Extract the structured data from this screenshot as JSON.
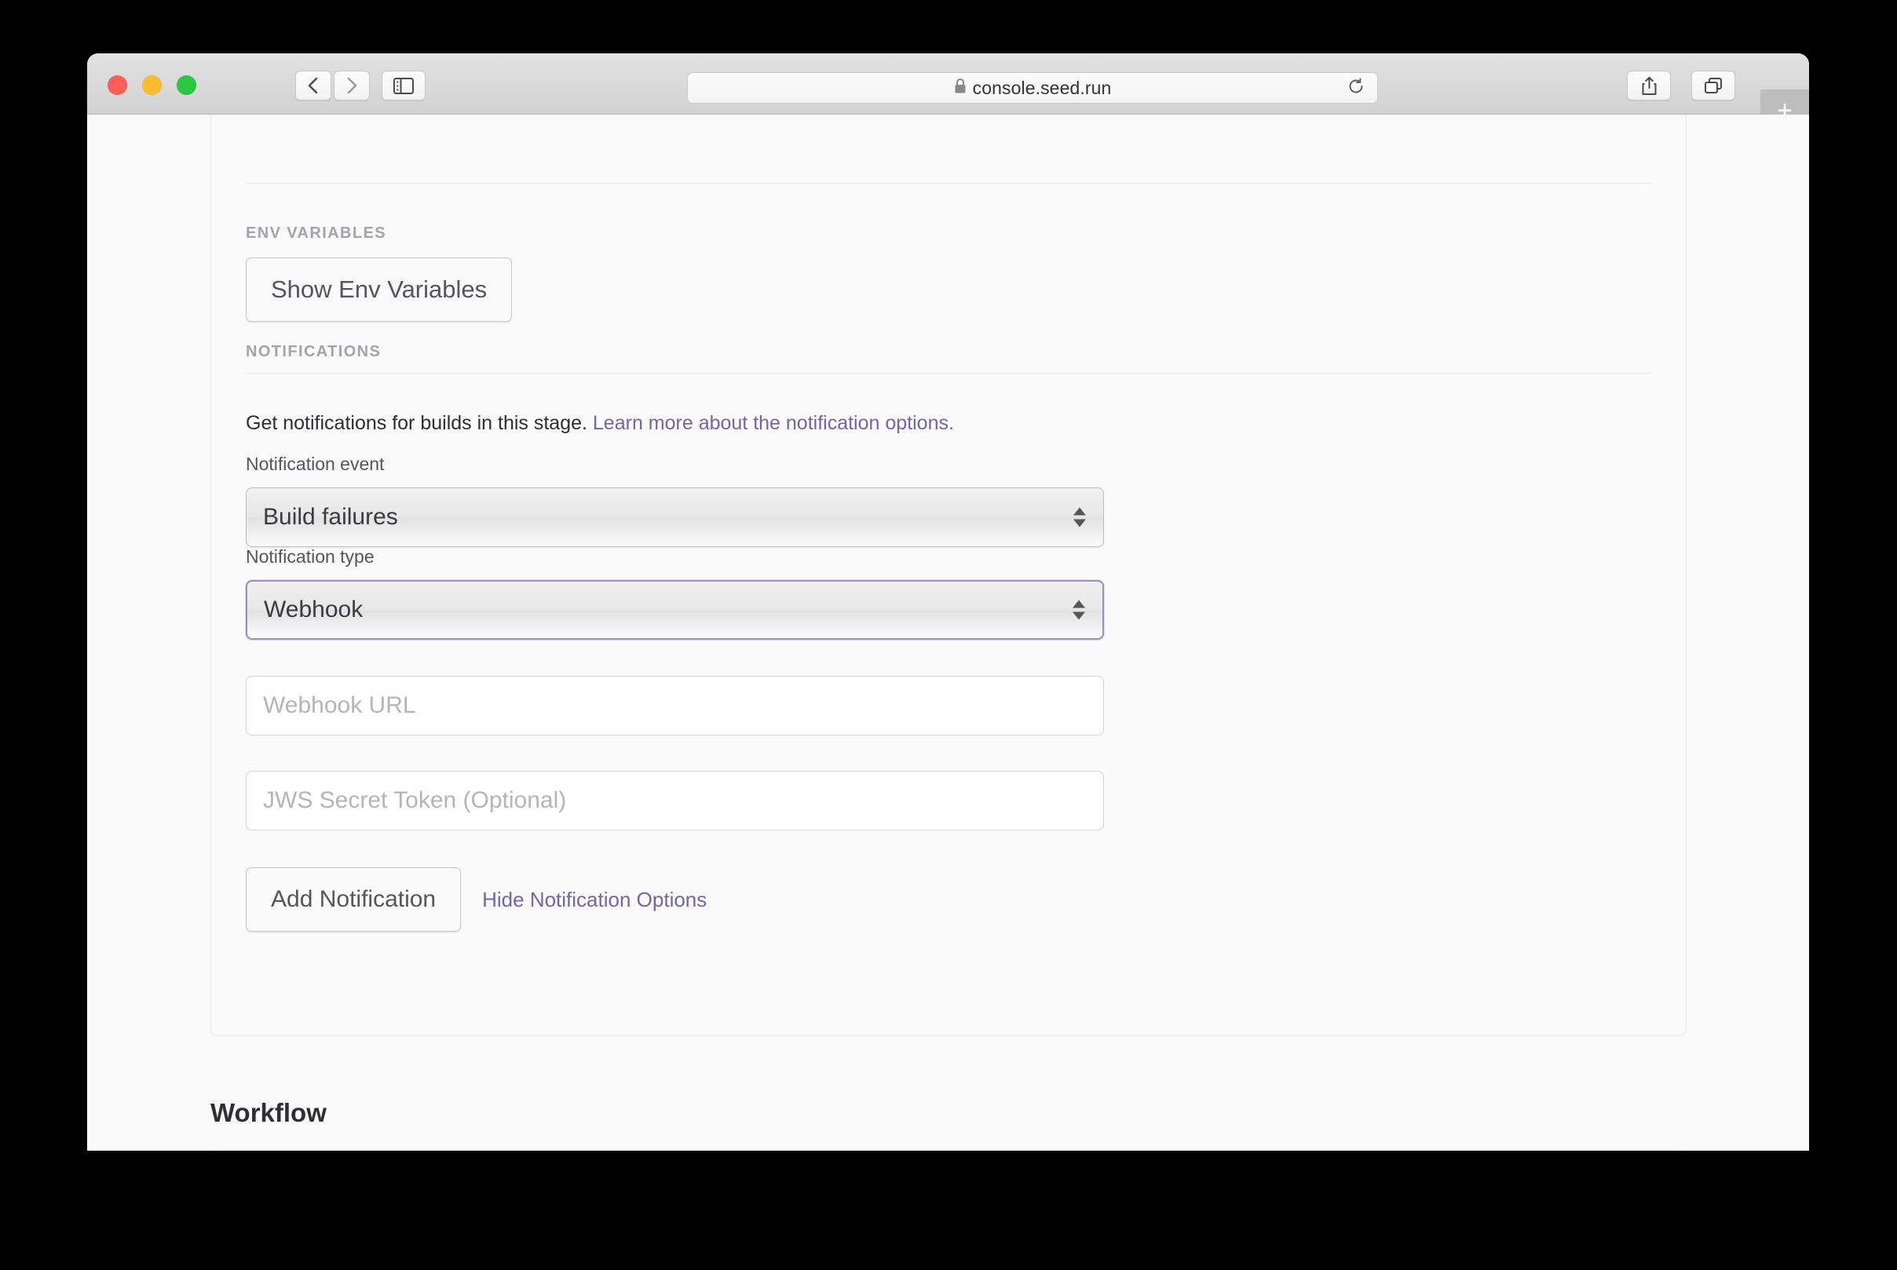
{
  "browser": {
    "url": "console.seed.run",
    "lock_icon": "lock-icon",
    "back_icon": "chevron-left-icon",
    "forward_icon": "chevron-right-icon",
    "sidebar_icon": "sidebar-toggle-icon",
    "reload_icon": "reload-icon",
    "share_icon": "share-icon",
    "tabs_icon": "tab-overview-icon",
    "new_tab_label": "+"
  },
  "env_variables": {
    "section_label": "ENV VARIABLES",
    "show_button_label": "Show Env Variables"
  },
  "notifications": {
    "section_label": "NOTIFICATIONS",
    "description": "Get notifications for builds in this stage.",
    "learn_more_link": "Learn more about the notification options.",
    "event": {
      "label": "Notification event",
      "selected": "Build failures"
    },
    "type": {
      "label": "Notification type",
      "selected": "Webhook"
    },
    "webhook_url": {
      "value": "",
      "placeholder": "Webhook URL"
    },
    "jws_token": {
      "value": "",
      "placeholder": "JWS Secret Token (Optional)"
    },
    "add_button_label": "Add Notification",
    "hide_options_link": "Hide Notification Options"
  },
  "workflow": {
    "heading": "Workflow"
  },
  "colors": {
    "accent_link": "#6f66ab",
    "focus_border": "#9b90bd",
    "page_bg": "#fafafa",
    "traffic_red": "#ff5f57",
    "traffic_yellow": "#febc2e",
    "traffic_green": "#28c840"
  }
}
